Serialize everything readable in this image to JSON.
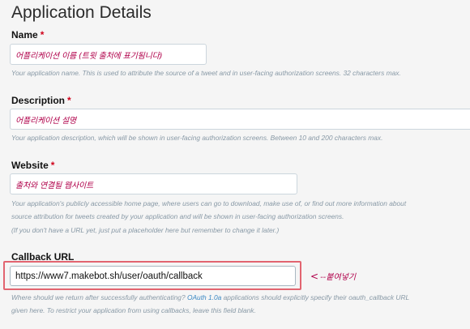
{
  "page": {
    "title": "Application Details"
  },
  "form": {
    "name": {
      "label": "Name",
      "required_mark": "*",
      "value": "어플리케이션 이름 (트윗 출처에 표기됨니다)",
      "help": "Your application name. This is used to attribute the source of a tweet and in user-facing authorization screens. 32 characters max."
    },
    "description": {
      "label": "Description",
      "required_mark": "*",
      "value": "어플리케이션 설명",
      "help": "Your application description, which will be shown in user-facing authorization screens. Between 10 and 200 characters max."
    },
    "website": {
      "label": "Website",
      "required_mark": "*",
      "value": "출처와 연결될 웹사이트",
      "help_line1": "Your application's publicly accessible home page, where users can go to download, make use of, or find out more information about",
      "help_line2": "source attribution for tweets created by your application and will be shown in user-facing authorization screens.",
      "help_line3": "(If you don't have a URL yet, just put a placeholder here but remember to change it later.)"
    },
    "callback_url": {
      "label": "Callback URL",
      "value": "https://www7.makebot.sh/user/oauth/callback",
      "help_line1_before": "Where should we return after successfully authenticating?",
      "help_line1_link": "OAuth 1.0a",
      "help_line1_after": "applications should explicitly specify their oauth_callback URL",
      "help_line2": "given here. To restrict your application from using callbacks, leave this field blank."
    }
  },
  "annotation": {
    "arrow": "<",
    "text": "--붙여넣기"
  },
  "colors": {
    "background": "#f5f5f5",
    "required": "#d0021b",
    "help_text": "#8899a6",
    "link": "#3b88c3",
    "highlight_box": "#e26470",
    "handwriting": "#b0004a"
  }
}
